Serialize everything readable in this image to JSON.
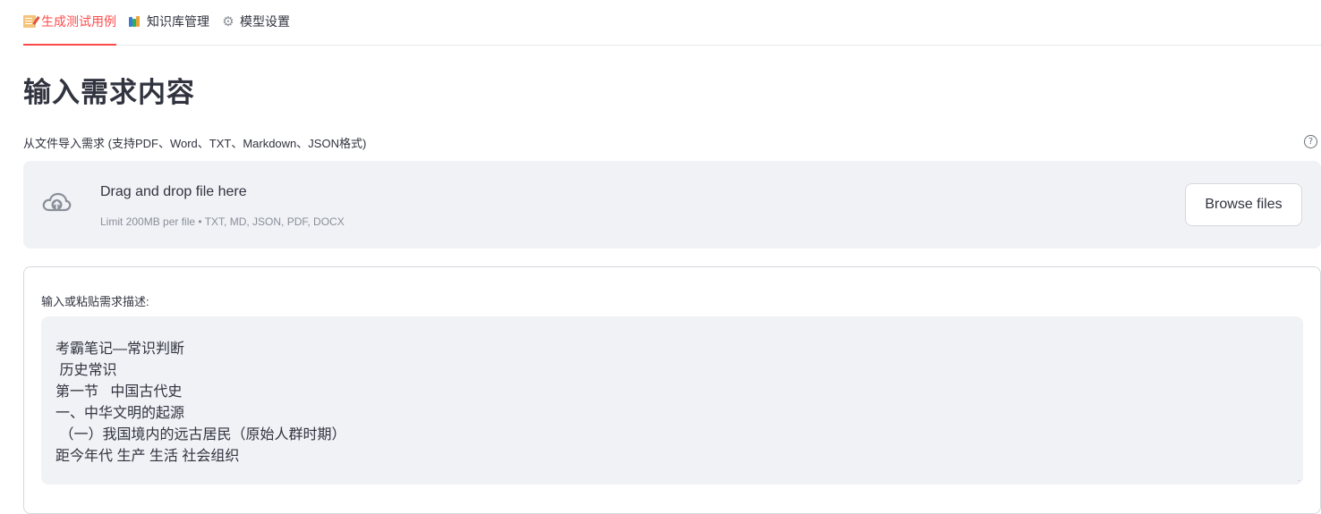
{
  "tabs": [
    {
      "label": "生成测试用例",
      "icon": "memo-icon",
      "active": true
    },
    {
      "label": "知识库管理",
      "icon": "books-icon",
      "active": false
    },
    {
      "label": "模型设置",
      "icon": "gear-icon",
      "active": false
    }
  ],
  "main": {
    "title": "输入需求内容",
    "uploader": {
      "label": "从文件导入需求 (支持PDF、Word、TXT、Markdown、JSON格式)",
      "help_icon": "question-circle-icon",
      "drop_title": "Drag and drop file here",
      "drop_limit": "Limit 200MB per file • TXT, MD, JSON, PDF, DOCX",
      "browse_label": "Browse files",
      "upload_icon": "cloud-upload-icon"
    },
    "textarea": {
      "label": "输入或粘贴需求描述:",
      "lines": [
        "考霸笔记—常识判断",
        " 历史常识",
        "第一节   中国古代史",
        "一、中华文明的起源",
        " （一）我国境内的远古居民（原始人群时期）",
        "距今年代 生产 生活 社会组织"
      ]
    }
  },
  "colors": {
    "accent": "#ff4b4b",
    "panel_bg": "#f0f2f6",
    "text": "#31333f",
    "muted": "#8a8f99",
    "border": "#d5d8de"
  }
}
